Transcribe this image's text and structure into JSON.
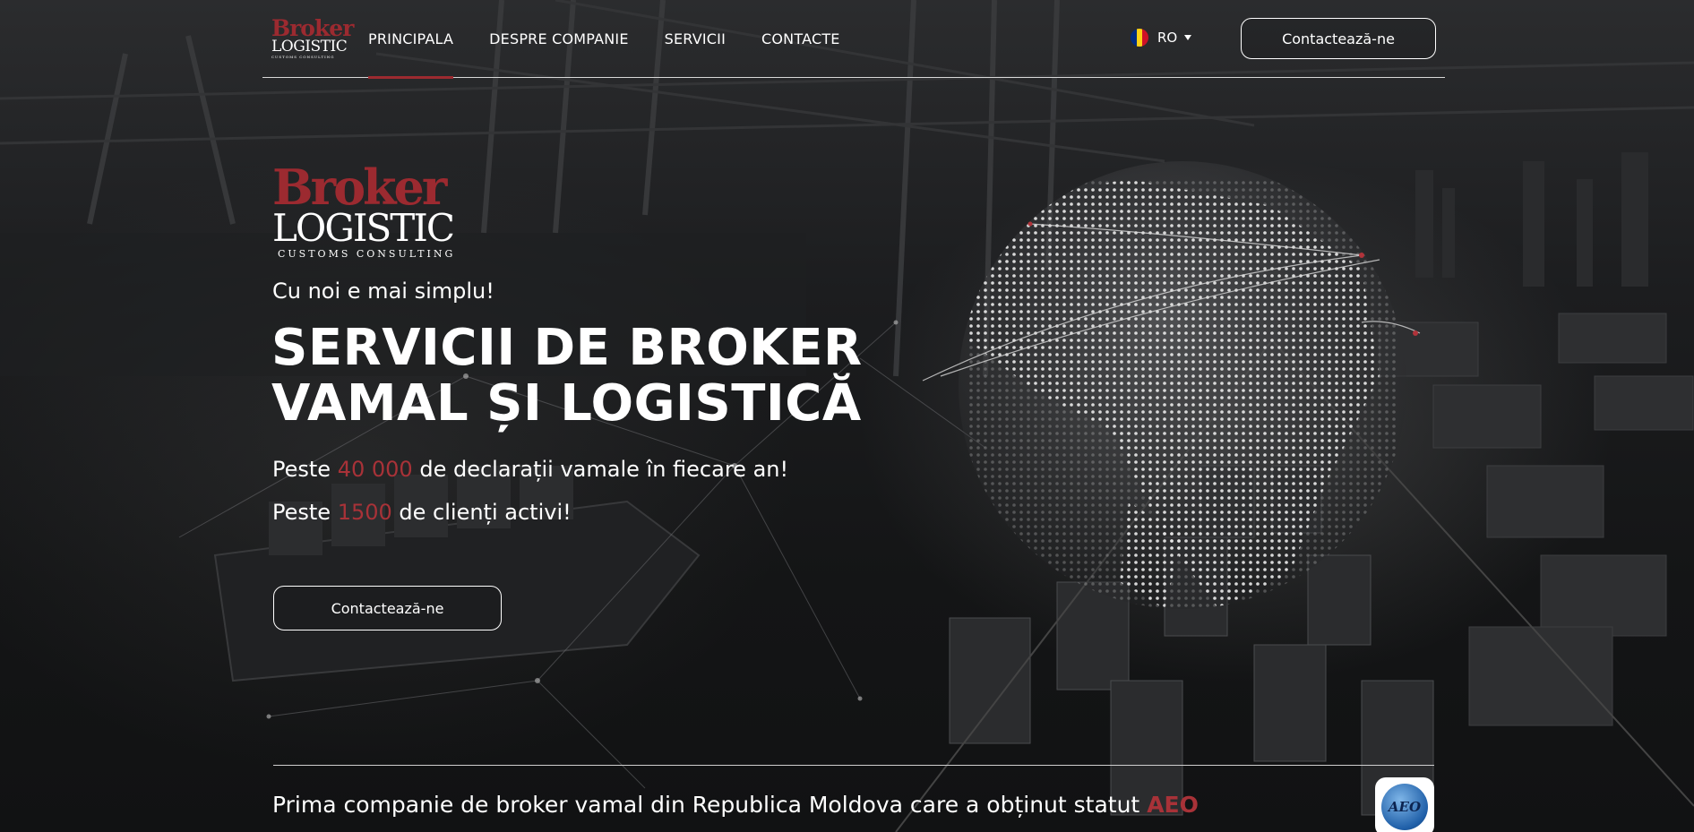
{
  "brand": {
    "logo_top": "Broker",
    "logo_main": "LOGISTIC",
    "logo_sub": "CUSTOMS CONSULTING"
  },
  "nav": {
    "items": [
      {
        "label": "PRINCIPALA",
        "active": true
      },
      {
        "label": "DESPRE COMPANIE",
        "active": false
      },
      {
        "label": "SERVICII",
        "active": false
      },
      {
        "label": "CONTACTE",
        "active": false
      }
    ]
  },
  "language": {
    "current": "RO",
    "flag_colors": [
      "#002B7F",
      "#FCD116",
      "#CE1126"
    ]
  },
  "header_cta": "Contactează-ne",
  "hero": {
    "tagline": "Cu noi e mai simplu!",
    "headline_line1": "SERVICII DE BROKER",
    "headline_line2": "VAMAL ȘI LOGISTICĂ",
    "stat1_prefix": "Peste",
    "stat1_value": "40 000",
    "stat1_suffix": "de declarații vamale în fiecare an!",
    "stat2_prefix": "Peste",
    "stat2_value": "1500",
    "stat2_suffix": "de clienți activi!",
    "cta": "Contactează-ne"
  },
  "aeo": {
    "text": "Prima companie de broker vamal din Republica Moldova care a obținut statut",
    "highlight": "AEO",
    "badge_label": "AEO"
  },
  "colors": {
    "accent": "#9C2A30",
    "highlight": "#A83238",
    "background": "#151617"
  },
  "icons": {
    "language_caret": "caret-down-icon",
    "flag": "romania-flag-icon"
  }
}
